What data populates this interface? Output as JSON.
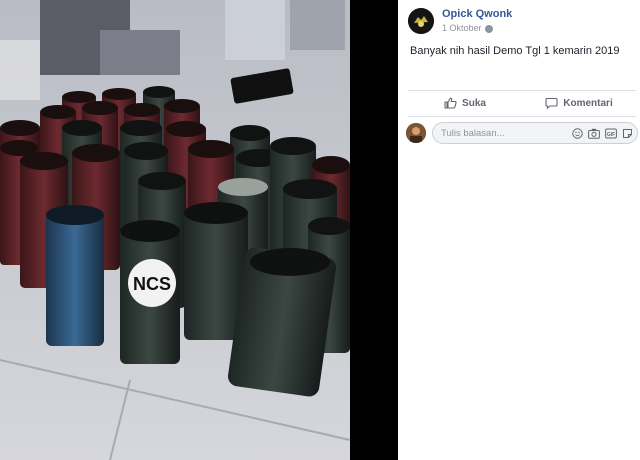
{
  "post": {
    "author": "Opick Qwonk",
    "date": "1 Oktober",
    "text": "Banyak nih hasil Demo Tgl 1 kemarin 2019"
  },
  "actions": {
    "like_label": "Suka",
    "comment_label": "Komentari"
  },
  "comment_box": {
    "placeholder": "Tulis balasan..."
  },
  "photo": {
    "label_text": "NCS"
  },
  "colors": {
    "link": "#365899",
    "muted": "#90949c",
    "text": "#1d2129",
    "divider": "#dddfe2"
  }
}
